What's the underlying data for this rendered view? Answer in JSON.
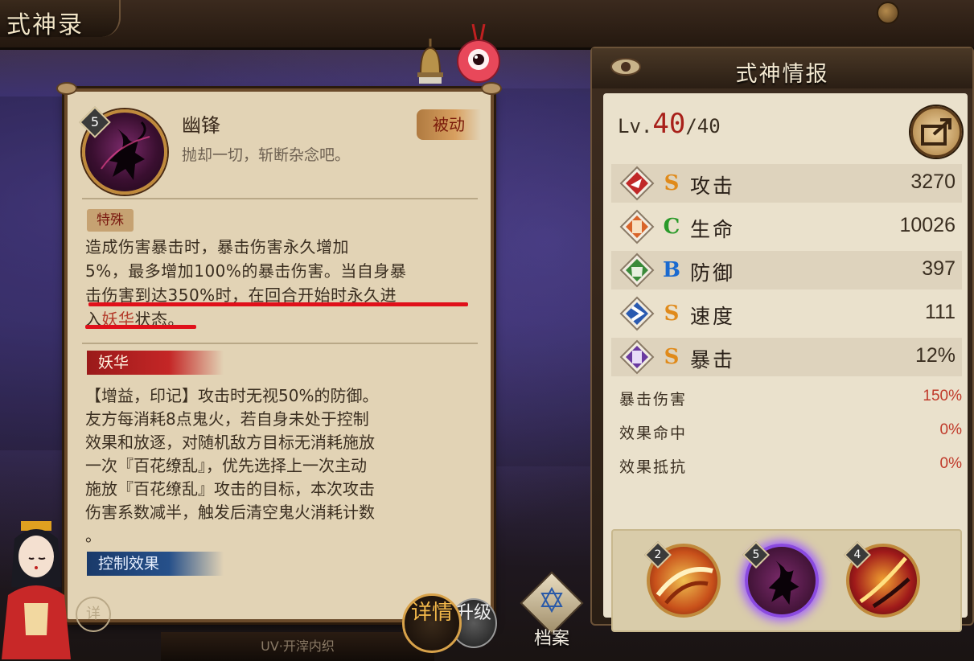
{
  "page": {
    "title": "式神录"
  },
  "skill": {
    "level": "5",
    "name": "幽锋",
    "quote": "抛却一切，斩断杂念吧。",
    "type_tag": "被动",
    "special_tag": "特殊",
    "special_line1": "造成伤害暴击时，暴击伤害永久增加",
    "special_line2": "5%，最多增加100%的暴击伤害。当自身暴",
    "special_line3": "击伤害到达350%时，在回合开始时永久进",
    "special_line4_a": "入",
    "special_line4_hl": "妖华",
    "special_line4_b": "状态。",
    "yaohua_tag": "妖华",
    "yaohua_lines": [
      "【增益，印记】攻击时无视50%的防御。",
      "友方每消耗8点鬼火，若自身未处于控制",
      "效果和放逐，对随机敌方目标无消耗施放",
      "一次『百花缭乱』，优先选择上一次主动",
      "施放『百花缭乱』攻击的目标，本次攻击",
      "伤害系数减半，触发后清空鬼火消耗计数",
      "。"
    ],
    "control_tag": "控制效果",
    "detail_button": "详"
  },
  "bottom": {
    "strip_text": "UV·开滓内织",
    "tab_detail": "详情",
    "tab_upgrade": "升级",
    "tab_archive": "档案"
  },
  "info_panel": {
    "title": "式神情报",
    "lv_prefix": "Lv.",
    "lv_current": "40",
    "lv_max": "/40",
    "stats": [
      {
        "name": "攻击",
        "grade": "S",
        "grade_color": "#e08a1a",
        "value": "3270",
        "icon": "attack-icon"
      },
      {
        "name": "生命",
        "grade": "C",
        "grade_color": "#2a9a2a",
        "value": "10026",
        "icon": "health-icon"
      },
      {
        "name": "防御",
        "grade": "B",
        "grade_color": "#1a6ad0",
        "value": "397",
        "icon": "defense-icon"
      },
      {
        "name": "速度",
        "grade": "S",
        "grade_color": "#e08a1a",
        "value": "111",
        "icon": "speed-icon"
      },
      {
        "name": "暴击",
        "grade": "S",
        "grade_color": "#e08a1a",
        "value": "12%",
        "icon": "crit-icon"
      }
    ],
    "sub_stats": [
      {
        "name": "暴击伤害",
        "value": "150%"
      },
      {
        "name": "效果命中",
        "value": "0%"
      },
      {
        "name": "效果抵抗",
        "value": "0%"
      }
    ],
    "skills": [
      {
        "level": "2",
        "selected": false
      },
      {
        "level": "5",
        "selected": true
      },
      {
        "level": "4",
        "selected": false
      }
    ]
  }
}
